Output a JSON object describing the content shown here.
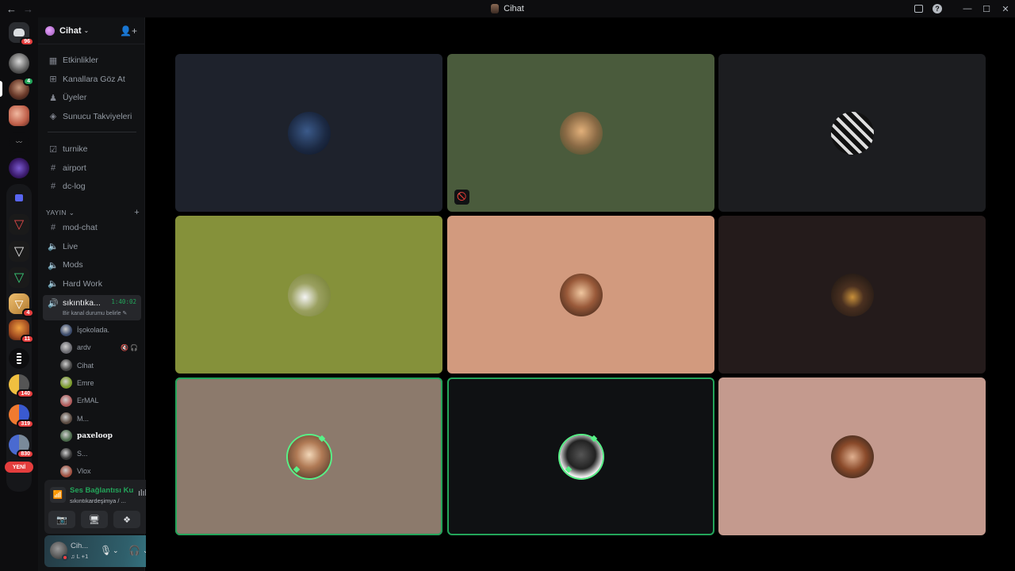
{
  "titlebar": {
    "title": "Cihat",
    "back_glyph": "←",
    "forward_glyph": "→",
    "help_glyph": "?",
    "minimize_glyph": "—",
    "maximize_glyph": "☐",
    "close_glyph": "✕"
  },
  "rail": {
    "badges": {
      "home": "96",
      "friend2": "4",
      "server9": "4",
      "server10": "11",
      "group1": "140",
      "group2": "319",
      "group3": "830"
    },
    "new_label": "YENİ"
  },
  "guild": {
    "name": "Cihat",
    "chevron": "⌄",
    "invite_glyph": "👤+"
  },
  "nav": [
    {
      "label": "Etkinlikler",
      "icon": "calendar-icon",
      "glyph": "▦"
    },
    {
      "label": "Kanallara Göz At",
      "icon": "browse-channels-icon",
      "glyph": "⊞"
    },
    {
      "label": "Üyeler",
      "icon": "members-icon",
      "glyph": "♟"
    },
    {
      "label": "Sunucu Takviyeleri",
      "icon": "boost-icon",
      "glyph": "◈"
    }
  ],
  "channels_top": [
    {
      "label": "turnike",
      "icon": "rules-icon",
      "glyph": "☑"
    },
    {
      "label": "airport",
      "icon": "hash-icon",
      "glyph": "#"
    },
    {
      "label": "dc-log",
      "icon": "hash-icon",
      "glyph": "#"
    }
  ],
  "category": {
    "label": "YAYIN",
    "chevron": "⌄",
    "plus": "+"
  },
  "channels_yayin": [
    {
      "label": "mod-chat",
      "icon": "hash-icon",
      "glyph": "#"
    },
    {
      "label": "Live",
      "icon": "speaker-icon",
      "glyph": "🔈"
    },
    {
      "label": "Mods",
      "icon": "speaker-icon",
      "glyph": "🔈"
    },
    {
      "label": "Hard Work",
      "icon": "speaker-icon",
      "glyph": "🔈"
    }
  ],
  "active_channel": {
    "label": "sıkıntıka...",
    "glyph": "🔊",
    "time": "1:40:02",
    "status": "Bir kanal durumu belirle ✎"
  },
  "voice_users": [
    {
      "name": "İşokolada.",
      "color": "#3a4a6a"
    },
    {
      "name": "ardv",
      "color": "#6a6a70",
      "mutes": "🔇🎧"
    },
    {
      "name": "Cihat",
      "color": "#444"
    },
    {
      "name": "Emre",
      "color": "#7a9a2a"
    },
    {
      "name": "ErMAL",
      "color": "#b05a5a"
    },
    {
      "name": "M...",
      "color": "#5a4a40"
    },
    {
      "name": "paxeloop",
      "color": "#4a6a4a",
      "bold": true
    },
    {
      "name": "S...",
      "color": "#333"
    },
    {
      "name": "Vlox",
      "color": "#a05040"
    }
  ],
  "voice_panel": {
    "title": "Ses Bağlantısı Ku",
    "subtitle": "sıkıntıkardeşimya / ...",
    "signal_glyph": "📶",
    "wave_glyph": "ılıl",
    "disconnect_glyph": "☎",
    "camera_glyph": "📷",
    "screen_glyph": "🖥",
    "activity_glyph": "❖",
    "soundboard_glyph": "♫"
  },
  "user_panel": {
    "name": "Cih...",
    "subtitle": "♫ L +1",
    "mic_glyph": "🎙",
    "headset_glyph": "🎧",
    "chevron": "⌄",
    "settings_glyph": "⚙"
  },
  "tiles": [
    {
      "bg": "#1e222c",
      "avatar": "radial-gradient(circle at 45% 45%, #3b5a8a 0%, #1c2a44 55%, #0c1220 100%)",
      "speaking": false
    },
    {
      "bg": "#4a5b3c",
      "avatar": "radial-gradient(circle at 50% 45%, #e2b07a 0%, #8a6a45 50%, #3a4a2a 100%)",
      "speaking": false,
      "noscreen": "🚫"
    },
    {
      "bg": "#1c1d20",
      "avatar": "repeating-linear-gradient(45deg, #111 0 6px, #ddd 6px 10px)",
      "speaking": false
    },
    {
      "bg": "#85913a",
      "avatar": "radial-gradient(circle at 40% 55%, #f4f4f4 0%, #9aa060 40%, #6e7a2a 100%)",
      "speaking": false
    },
    {
      "bg": "#d29a7e",
      "avatar": "radial-gradient(circle at 50% 45%, #f0c7a0 0%, #9a5a3a 45%, #2a1a12 100%)",
      "speaking": false
    },
    {
      "bg": "#241b1b",
      "avatar": "radial-gradient(circle at 50% 55%, #c8903a 0%, #4a3020 35%, #121010 100%)",
      "speaking": false
    },
    {
      "bg": "#8c7a6c",
      "avatar": "radial-gradient(circle at 50% 45%, #f2d7b8 0%, #b07a55 40%, #3a2a20 100%)",
      "speaking": true
    },
    {
      "bg": "#0f1113",
      "avatar": "radial-gradient(circle at 50% 45%, #555 0%, #222 45%, #f0f0f0 70%, #d8d8d8 100%)",
      "speaking": true
    },
    {
      "bg": "#c49a8e",
      "avatar": "radial-gradient(circle at 50% 50%, #e0b090 0%, #8a4a2a 45%, #1a1a1a 100%)",
      "speaking": false
    }
  ]
}
